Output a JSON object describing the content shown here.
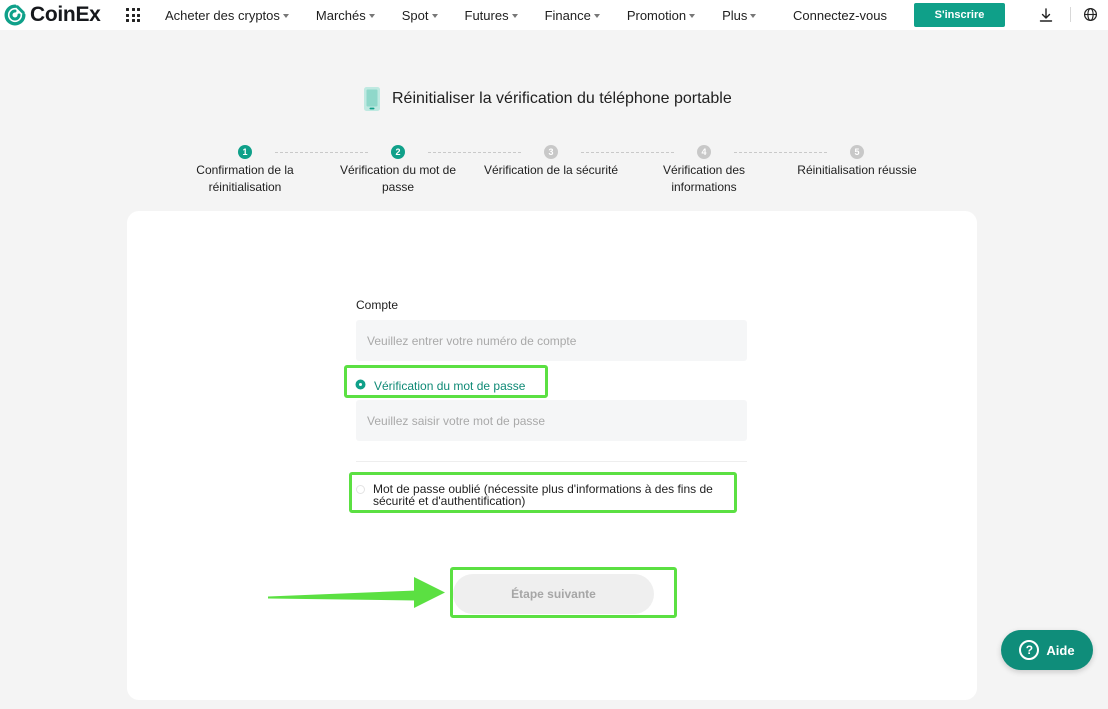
{
  "header": {
    "brand": "CoinEx",
    "nav": [
      {
        "label": "Acheter des cryptos"
      },
      {
        "label": "Marchés"
      },
      {
        "label": "Spot"
      },
      {
        "label": "Futures"
      },
      {
        "label": "Finance"
      },
      {
        "label": "Promotion"
      },
      {
        "label": "Plus"
      }
    ],
    "login_label": "Connectez-vous",
    "signup_label": "S'inscrire",
    "icons": [
      "grid-icon",
      "download-icon",
      "globe-icon"
    ]
  },
  "page": {
    "title": "Réinitialiser la vérification du téléphone portable",
    "title_icon": "phone-icon"
  },
  "steps": [
    {
      "number": "1",
      "label": "Confirmation de la réinitialisation",
      "active": true
    },
    {
      "number": "2",
      "label": "Vérification du mot de passe",
      "active": true
    },
    {
      "number": "3",
      "label": "Vérification de la sécurité",
      "active": false
    },
    {
      "number": "4",
      "label": "Vérification des informations",
      "active": false
    },
    {
      "number": "5",
      "label": "Réinitialisation réussie",
      "active": false
    }
  ],
  "form": {
    "account_label": "Compte",
    "account_placeholder": "Veuillez entrer votre numéro de compte",
    "account_value": "",
    "option_password_label": "Vérification du mot de passe",
    "option_password_selected": true,
    "password_placeholder": "Veuillez saisir votre mot de passe",
    "password_value": "",
    "option_forgot_label": "Mot de passe oublié (nécessite plus d'informations à des fins de sécurité et d'authentification)",
    "option_forgot_selected": false,
    "next_label": "Étape suivante"
  },
  "help": {
    "label": "Aide",
    "icon_glyph": "?"
  },
  "colors": {
    "accent": "#0fa089",
    "annotation": "#5be042",
    "help_bg": "#0f8d7a"
  }
}
